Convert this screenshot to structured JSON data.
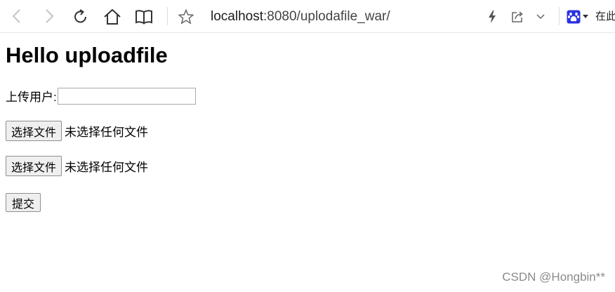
{
  "browser": {
    "url_host": "localhost",
    "url_rest": ":8080/uplodafile_war/",
    "search_label": "在此"
  },
  "icons": {
    "back": "back-arrow-icon",
    "forward": "forward-arrow-icon",
    "reload": "reload-icon",
    "home": "home-icon",
    "reader": "book-icon",
    "favorite": "star-icon",
    "lightning": "lightning-icon",
    "share": "share-icon",
    "menu": "chevron-down-icon",
    "search_engine": "baidu-paw-icon"
  },
  "page": {
    "title": "Hello uploadfile",
    "user_label": "上传用户:",
    "user_value": "",
    "file1_button": "选择文件",
    "file1_status": "未选择任何文件",
    "file2_button": "选择文件",
    "file2_status": "未选择任何文件",
    "submit_label": "提交"
  },
  "watermark": "CSDN @Hongbin**",
  "colors": {
    "baidu_blue": "#2932e1",
    "icon_gray": "#555555",
    "button_bg": "#efefef"
  }
}
